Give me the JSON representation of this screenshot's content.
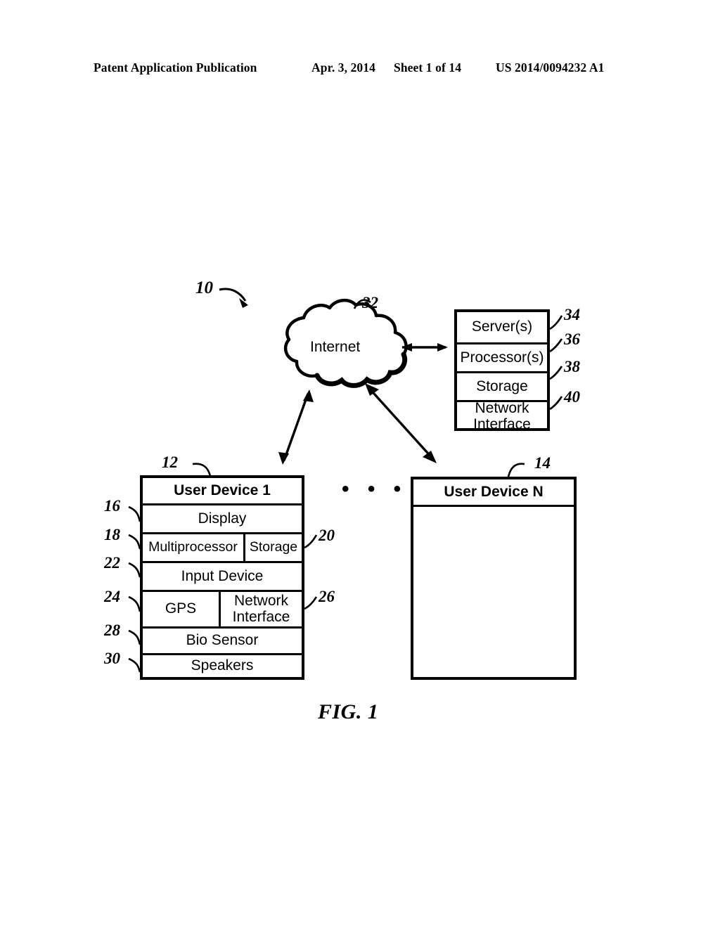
{
  "header": {
    "publication": "Patent Application Publication",
    "date": "Apr. 3, 2014",
    "sheet": "Sheet 1 of 14",
    "patent_number": "US 2014/0094232 A1"
  },
  "figure": {
    "caption": "FIG. 1",
    "system_ref": "10",
    "ellipsis": "• • •"
  },
  "cloud": {
    "label": "Internet",
    "ref": "32"
  },
  "server_box": {
    "ref_labels": [
      "34",
      "36",
      "38",
      "40"
    ],
    "rows": [
      {
        "label": "Server(s)",
        "ref": "34"
      },
      {
        "label": "Processor(s)",
        "ref": "36"
      },
      {
        "label": "Storage",
        "ref": "38"
      },
      {
        "label": "Network Interface",
        "ref": "40"
      }
    ]
  },
  "user_device_1": {
    "title": "User Device 1",
    "ref": "12",
    "rows": [
      {
        "label": "Display",
        "ref": "16"
      },
      {
        "label": "Multiprocessor",
        "ref": "18"
      },
      {
        "label": "Storage",
        "ref": "20"
      },
      {
        "label": "Input Device",
        "ref": "22"
      },
      {
        "label": "GPS",
        "ref": "24"
      },
      {
        "label": "Network Interface",
        "ref": "26"
      },
      {
        "label": "Bio Sensor",
        "ref": "28"
      },
      {
        "label": "Speakers",
        "ref": "30"
      }
    ]
  },
  "user_device_n": {
    "title": "User Device N",
    "ref": "14"
  },
  "colors": {
    "ink": "#000000",
    "page": "#ffffff"
  }
}
